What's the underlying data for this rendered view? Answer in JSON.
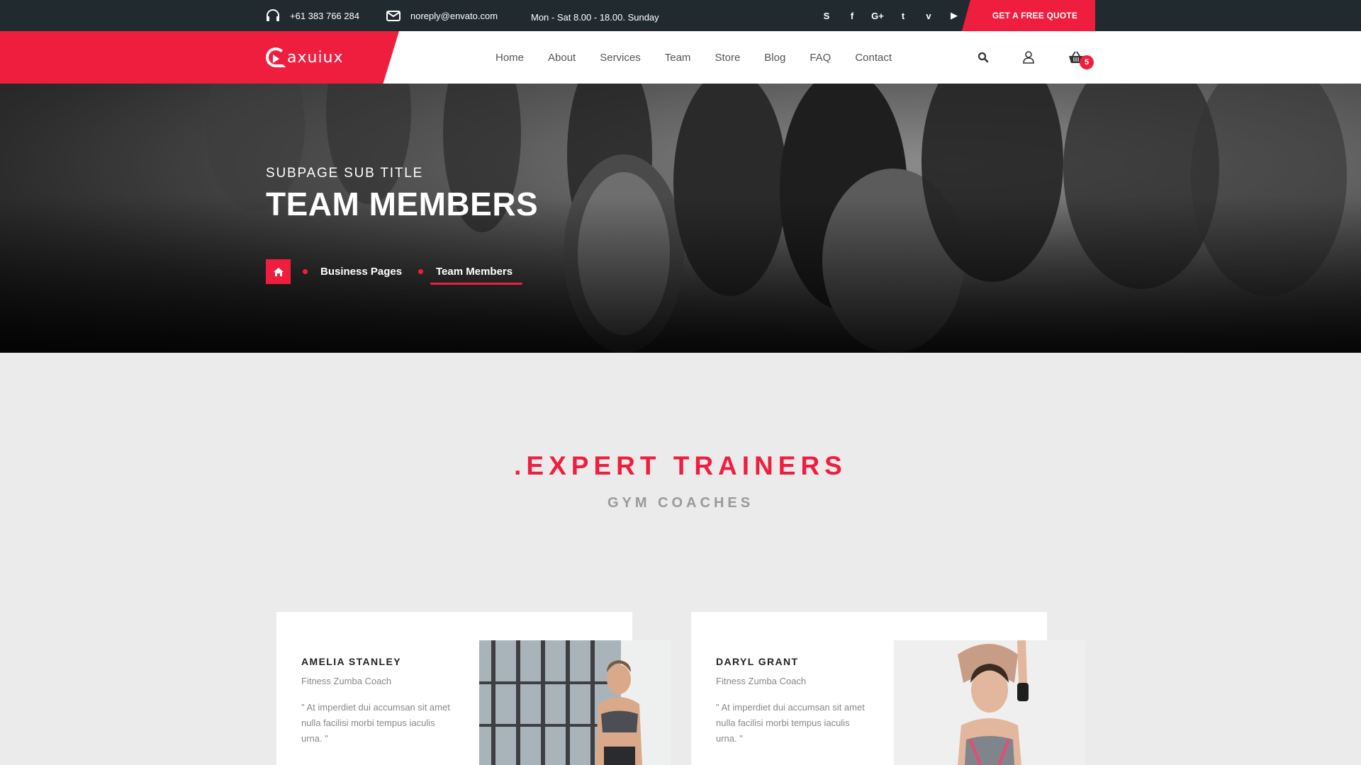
{
  "topbar": {
    "phone": "+61 383 766 284",
    "email": "noreply@envato.com",
    "hours": "Mon - Sat 8.00 - 18.00. Sunday",
    "social": [
      {
        "name": "skype-icon",
        "glyph": "S"
      },
      {
        "name": "facebook-icon",
        "glyph": "f"
      },
      {
        "name": "google-plus-icon",
        "glyph": "G+"
      },
      {
        "name": "twitter-icon",
        "glyph": "t"
      },
      {
        "name": "vimeo-icon",
        "glyph": "v"
      },
      {
        "name": "youtube-icon",
        "glyph": "▶"
      }
    ],
    "quote_label": "GET A FREE QUOTE"
  },
  "nav": {
    "logo_text": "axuiux",
    "menu": [
      "Home",
      "About",
      "Services",
      "Team",
      "Store",
      "Blog",
      "FAQ",
      "Contact"
    ],
    "cart_count": "5"
  },
  "hero": {
    "subtitle": "SUBPAGE SUB TITLE",
    "title": "TEAM MEMBERS",
    "breadcrumb": [
      "Business Pages",
      "Team Members"
    ]
  },
  "section": {
    "title": ".EXPERT TRAINERS",
    "subtitle": "GYM COACHES"
  },
  "trainers": [
    {
      "name": "AMELIA STANLEY",
      "role": "Fitness Zumba Coach",
      "quote": "\" At imperdiet dui accumsan sit amet nulla facilisi morbi tempus iaculis urna. \""
    },
    {
      "name": "DARYL GRANT",
      "role": "Fitness Zumba Coach",
      "quote": "\" At imperdiet dui accumsan sit amet nulla facilisi morbi tempus iaculis urna. \""
    }
  ],
  "colors": {
    "accent": "#f01e3e",
    "topbar": "#212b2f",
    "background": "#ebebeb"
  }
}
